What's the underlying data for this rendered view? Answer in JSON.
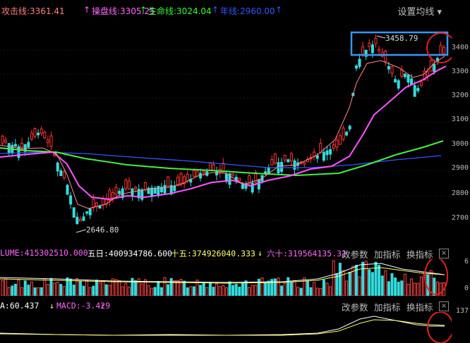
{
  "toolbar": {
    "ma1_label": "攻击线:3361.41",
    "ma2_label": "操盘线:3305.25",
    "ma3_label": "生命线:3024.04",
    "ma4_label": "年线:2960.00",
    "settings_label": "设置均线 ▾",
    "colors": {
      "ma1": "#ff8080",
      "ma2": "#ff66ff",
      "ma3": "#33ff33",
      "ma4": "#3355ff"
    }
  },
  "price_axis": {
    "ticks": [
      "3400",
      "3300",
      "3200",
      "3100",
      "3000",
      "2900",
      "2800",
      "2700"
    ]
  },
  "annotations": {
    "high_label": "3458.79",
    "low_label": "2646.80"
  },
  "volume_panel": {
    "vol_label": "LUME:415302510.000",
    "ma5_label": "五日:400934786.600",
    "ma15_label": "十五:374926040.333",
    "ma60_label": "六十:319564135.31",
    "params_button": "改参数",
    "add_indicator_button": "加指标",
    "switch_indicator_button": "换指标",
    "close_button": "×",
    "ticks": [
      "6",
      "0"
    ]
  },
  "macd_panel": {
    "a_label": "A:60.437",
    "macd_label": "MACD:-3.429",
    "params_button": "改参数",
    "add_indicator_button": "加指标",
    "switch_indicator_button": "换指标",
    "close_button": "×",
    "ticks": [
      "137"
    ]
  }
}
